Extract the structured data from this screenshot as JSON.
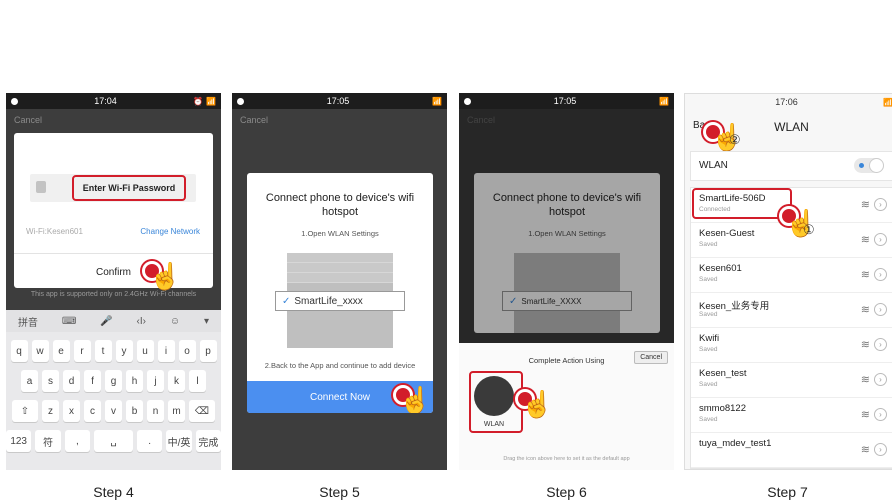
{
  "steps": [
    {
      "label": "Step 4"
    },
    {
      "label": "Step 5"
    },
    {
      "label": "Step 6"
    },
    {
      "label": "Step 7"
    }
  ],
  "step4": {
    "time": "17:04",
    "cancel": "Cancel",
    "password_label": "Enter Wi-Fi Password",
    "network": "Wi-Fi:Kesen601",
    "change_network": "Change Network",
    "confirm": "Confirm",
    "note": "This app is supported only on 2.4GHz Wi-Fi channels",
    "keyboard": {
      "top": [
        "拼音",
        "⌨",
        "🎤",
        "‹I›",
        "☺",
        "▾"
      ],
      "row1": [
        "q",
        "w",
        "e",
        "r",
        "t",
        "y",
        "u",
        "i",
        "o",
        "p"
      ],
      "row2": [
        "a",
        "s",
        "d",
        "f",
        "g",
        "h",
        "j",
        "k",
        "l"
      ],
      "row3": [
        "⇧",
        "z",
        "x",
        "c",
        "v",
        "b",
        "n",
        "m",
        "⌫"
      ],
      "row4": [
        "123",
        "符",
        ",",
        "␣",
        ".",
        "中/英",
        "完成"
      ]
    }
  },
  "step5": {
    "time": "17:05",
    "cancel": "Cancel",
    "title": "Connect phone to device's wifi hotspot",
    "step1": "1.Open WLAN Settings",
    "ssid": "SmartLife_xxxx",
    "step2": "2.Back to the App and continue to add device",
    "connect_now": "Connect Now"
  },
  "step6": {
    "time": "17:05",
    "cancel": "Cancel",
    "title": "Connect phone to device's wifi hotspot",
    "step1": "1.Open WLAN Settings",
    "ssid": "SmartLife_XXXX",
    "sheet_title": "Complete Action Using",
    "sheet_cancel": "Cancel",
    "app_label": "WLAN",
    "default_note": "Drag the icon above here to set it as the default app"
  },
  "step7": {
    "time": "17:06",
    "back": "Back",
    "title": "WLAN",
    "toggle_label": "WLAN",
    "callout1": "①",
    "callout2": "②",
    "networks": [
      {
        "name": "SmartLife-506D",
        "status": "Connected"
      },
      {
        "name": "Kesen-Guest",
        "status": "Saved"
      },
      {
        "name": "Kesen601",
        "status": "Saved"
      },
      {
        "name": "Kesen_业务专用",
        "status": "Saved"
      },
      {
        "name": "Kwifi",
        "status": "Saved"
      },
      {
        "name": "Kesen_test",
        "status": "Saved"
      },
      {
        "name": "smmo8122",
        "status": "Saved"
      },
      {
        "name": "tuya_mdev_test1",
        "status": ""
      }
    ]
  },
  "colors": {
    "highlight": "#d21d2a",
    "accent": "#4b8ff0",
    "phone_bg": "#3d3d3d"
  }
}
